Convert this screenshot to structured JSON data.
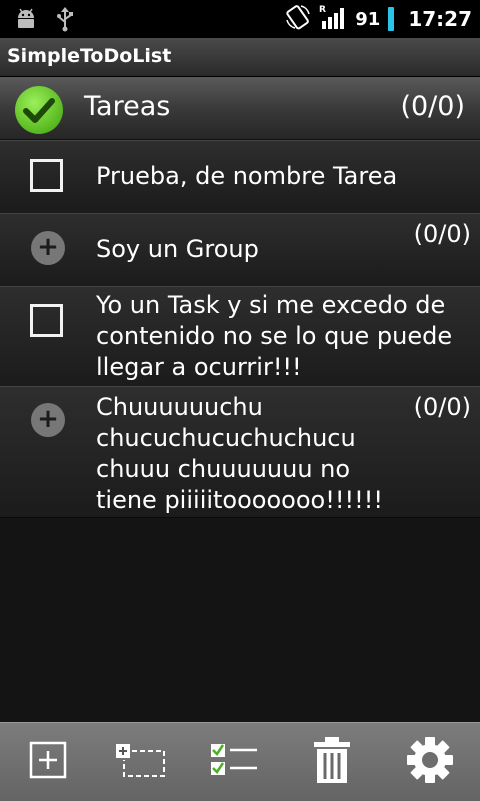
{
  "status_bar": {
    "battery": "91",
    "time": "17:27",
    "icons": [
      "android-debug-icon",
      "usb-icon",
      "screen-rotation-icon",
      "signal-roaming-icon",
      "battery-icon"
    ]
  },
  "app": {
    "title": "SimpleToDoList"
  },
  "header": {
    "title": "Tareas",
    "count": "(0/0)"
  },
  "items": [
    {
      "type": "task",
      "text": "Prueba, de nombre Tarea"
    },
    {
      "type": "group",
      "text": "Soy un Group",
      "count": "(0/0)"
    },
    {
      "type": "task",
      "lines": [
        "Yo un Task y si me excedo de",
        "contenido no se lo que puede",
        "llegar a ocurrir!!!"
      ]
    },
    {
      "type": "group",
      "lines": [
        "Chuuuuuuchu",
        "chucuchucuchuchucu",
        "chuuu chuuuuuuu no",
        "tiene piiiiitooooooo!!!!!!"
      ],
      "count": "(0/0)"
    }
  ],
  "toolbar": {
    "buttons": [
      "add-task-icon",
      "add-group-icon",
      "checklist-icon",
      "trash-icon",
      "settings-gear-icon"
    ]
  },
  "colors": {
    "accent_green": "#6fd42a",
    "battery": "#29c4e8",
    "toolbar": "#707070"
  }
}
